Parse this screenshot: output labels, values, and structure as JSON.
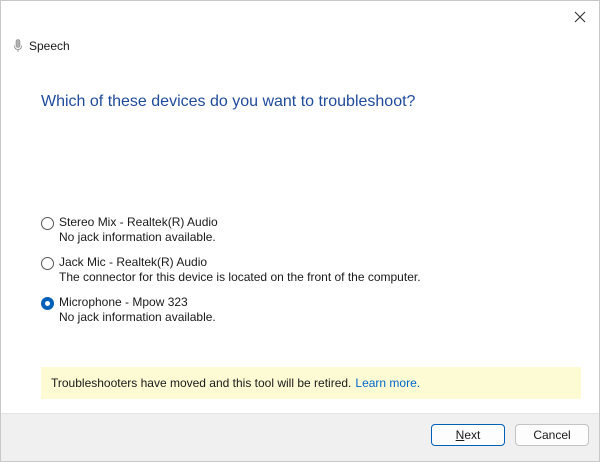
{
  "window": {
    "title": "Speech",
    "close_icon": "close-icon",
    "title_icon": "microphone-icon"
  },
  "heading": "Which of these devices do you want to troubleshoot?",
  "devices": [
    {
      "name": "Stereo Mix - Realtek(R) Audio",
      "detail": "No jack information available.",
      "selected": false
    },
    {
      "name": "Jack Mic - Realtek(R) Audio",
      "detail": "The connector for this device is located on the front of the computer.",
      "selected": false
    },
    {
      "name": "Microphone - Mpow 323",
      "detail": "No jack information available.",
      "selected": true
    }
  ],
  "notice": {
    "text": "Troubleshooters have moved and this tool will be retired.",
    "link": "Learn more.",
    "background": "#fdfbd3",
    "link_color": "#0066cc"
  },
  "buttons": {
    "next_label": "Next",
    "cancel_label": "Cancel"
  },
  "colors": {
    "accent": "#005fb8",
    "heading": "#1f4b9c"
  }
}
